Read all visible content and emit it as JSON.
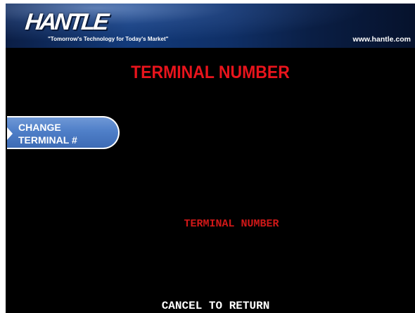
{
  "header": {
    "logo_text": "HANTLE",
    "tagline": "\"Tomorrow's Technology for Today's Market\"",
    "website": "www.hantle.com"
  },
  "screen": {
    "title": "TERMINAL NUMBER",
    "field_label": "TERMINAL NUMBER",
    "footer": "CANCEL TO RETURN"
  },
  "side_buttons": {
    "change_terminal": {
      "line1": "CHANGE",
      "line2": "TERMINAL #"
    }
  },
  "colors": {
    "title_red": "#e8141c",
    "button_blue": "#4f7fc8",
    "background": "#000000"
  }
}
